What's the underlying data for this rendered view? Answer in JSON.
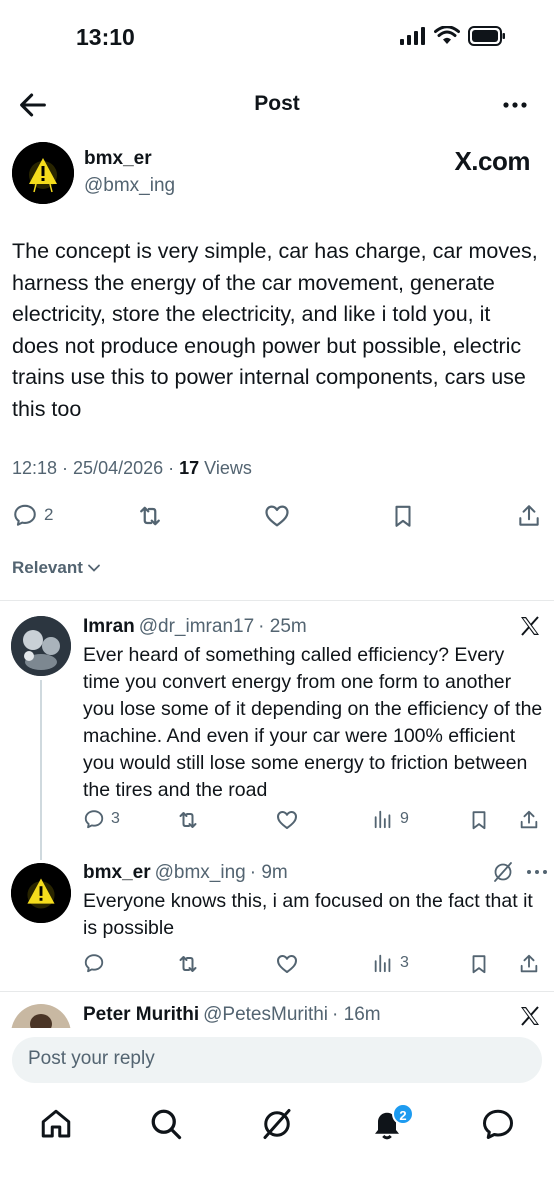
{
  "status_bar": {
    "time": "13:10"
  },
  "header": {
    "title": "Post",
    "back_icon": "arrow-left-icon",
    "more_icon": "more-dots-icon"
  },
  "post": {
    "author_name": "bmx_er",
    "author_handle": "@bmx_ing",
    "source_label": "X.com",
    "text": "The concept is very simple, car has charge, car moves, harness the energy of the car movement, generate electricity, store the electricity, and like i told you, it does not produce enough power but possible, electric trains use this to power internal components, cars use this too",
    "timestamp": "12:18 · 25/04/2026 · ",
    "views_count": "17",
    "views_label": " Views",
    "actions": {
      "replies": "2"
    }
  },
  "sort": {
    "label": "Relevant"
  },
  "replies": [
    {
      "name": "Imran",
      "handle": "@dr_imran17",
      "time": "· 25m",
      "text": "Ever heard of something called efficiency? Every time you convert energy from one form to another you lose some of it depending on the efficiency of the machine. And even if your car were 100% efficient you would still lose some energy to friction between the tires and the road",
      "reply_count": "3",
      "views": "9"
    },
    {
      "name": "bmx_er",
      "handle": "@bmx_ing",
      "time": "· 9m",
      "text": "Everyone knows this, i am focused on the fact that it is possible",
      "reply_count": "",
      "views": "3"
    },
    {
      "name": "Peter Murithi",
      "handle": "@PetesMurithi",
      "time": "· 16m"
    }
  ],
  "reply_input": {
    "placeholder": "Post your reply"
  },
  "bottom_nav": {
    "notifications_badge": "2"
  },
  "colors": {
    "accent": "#1d9bf0",
    "text": "#0f1419",
    "muted": "#536471"
  }
}
